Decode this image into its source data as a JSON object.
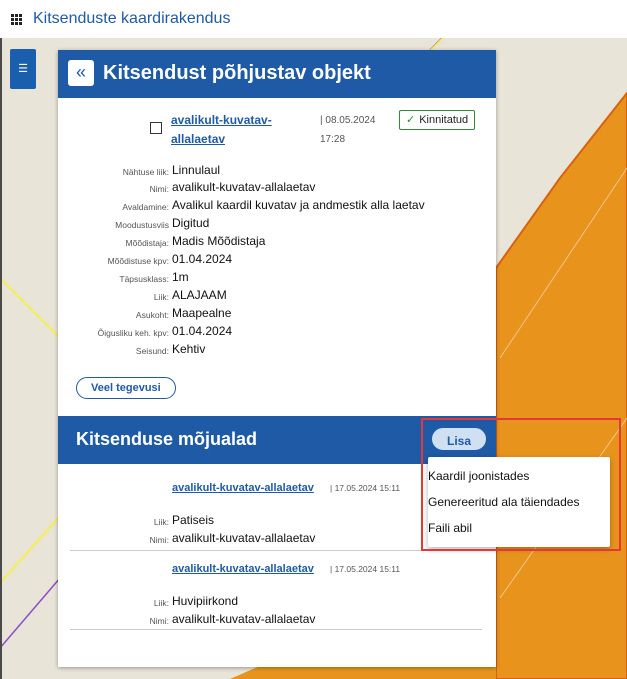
{
  "app": {
    "title": "Kitsenduste kaardirakendus"
  },
  "icons": {
    "apps": "grid-icon",
    "sidebar_toggle": "list-indent-icon",
    "back": "chevron-left-icon",
    "object": "bounding-box-icon",
    "status": "check-icon"
  },
  "sidebar_toggle": {
    "glyph": "☰"
  },
  "panel": {
    "back_glyph": "«",
    "title": "Kitsendust põhjustav objekt",
    "object": {
      "link_line1": "avalikult-kuvatav-",
      "link_line2": "allalaetav",
      "date_line1": "| 08.05.2024",
      "date_line2": "17:28",
      "status": "Kinnitatud"
    },
    "properties": [
      {
        "label": "Nähtuse liik:",
        "value": "Linnulaul"
      },
      {
        "label": "Nimi:",
        "value": "avalikult-kuvatav-allalaetav"
      },
      {
        "label": "Avaldamine:",
        "value": "Avalikul kaardil kuvatav ja andmestik alla laetav"
      },
      {
        "label": "Moodustusviis",
        "value": "Digitud"
      },
      {
        "label": "Mõõdistaja:",
        "value": "Madis Mõõdistaja"
      },
      {
        "label": "Mõõdistuse kpv:",
        "value": "01.04.2024"
      },
      {
        "label": "Täpsusklass:",
        "value": "1m"
      },
      {
        "label": "Liik:",
        "value": "ALAJAAM"
      },
      {
        "label": "Asukoht:",
        "value": "Maapealne"
      },
      {
        "label": "Õigusliku keh. kpv:",
        "value": "01.04.2024"
      },
      {
        "label": "Seisund:",
        "value": "Kehtiv"
      }
    ],
    "more_button": "Veel tegevusi",
    "section_title": "Kitsenduse mõjualad",
    "add_button": "Lisa",
    "areas": [
      {
        "link": "avalikult-kuvatav-allalaetav",
        "date": "| 17.05.2024 15:11",
        "fields": [
          {
            "label": "Liik:",
            "value": "Patiseis"
          },
          {
            "label": "Nimi:",
            "value": "avalikult-kuvatav-allalaetav"
          }
        ]
      },
      {
        "link": "avalikult-kuvatav-allalaetav",
        "date": "| 17.05.2024 15:11",
        "fields": [
          {
            "label": "Liik:",
            "value": "Huvipiirkond"
          },
          {
            "label": "Nimi:",
            "value": "avalikult-kuvatav-allalaetav"
          }
        ]
      }
    ]
  },
  "dropdown": {
    "items": [
      "Kaardil joonistades",
      "Genereeritud ala täiendades",
      "Faili abil"
    ]
  },
  "colors": {
    "primary": "#1f5aa6",
    "map_bg": "#e8e4d8",
    "orange_fill": "#e8941c",
    "orange_border": "#d9620f",
    "highlight": "#e53935",
    "status_green": "#2e8b3a"
  }
}
